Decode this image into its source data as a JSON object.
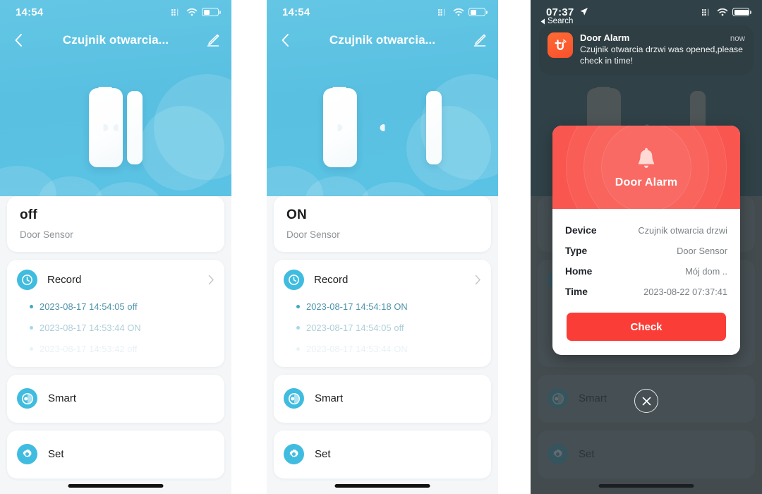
{
  "app": {
    "accent_blue": "#3fbcdf",
    "hero_blue": "#5bc3e4",
    "alarm_red": "#f9564f",
    "check_red": "#fa3e37"
  },
  "panels": [
    {
      "id": "closed-state",
      "status_bar": {
        "time": "14:54",
        "cellular_icon": "cellular-dots-icon",
        "wifi_icon": "wifi-icon",
        "battery_icon": "battery-icon",
        "battery_level": 45
      },
      "nav": {
        "back_icon": "chevron-left-icon",
        "title": "Czujnik otwarcia...",
        "edit_icon": "pencil-edit-icon"
      },
      "device": {
        "illustration": "door-sensor-closed",
        "state": "closed"
      },
      "state_card": {
        "value": "off",
        "subtitle": "Door Sensor"
      },
      "record_card": {
        "icon": "clock-icon",
        "label": "Record",
        "chevron_icon": "chevron-right-icon",
        "entries": [
          {
            "text": "2023-08-17 14:54:05 off",
            "opacity": 1.0
          },
          {
            "text": "2023-08-17 14:53:44 ON",
            "opacity": 0.45
          },
          {
            "text": "2023-08-17 14:53:42 off",
            "opacity": 0.12
          }
        ]
      },
      "rows": [
        {
          "icon": "smart-toggle-icon",
          "label": "Smart"
        },
        {
          "icon": "gear-icon",
          "label": "Set"
        }
      ]
    },
    {
      "id": "open-state",
      "status_bar": {
        "time": "14:54",
        "cellular_icon": "cellular-dots-icon",
        "wifi_icon": "wifi-icon",
        "battery_icon": "battery-icon",
        "battery_level": 45
      },
      "nav": {
        "back_icon": "chevron-left-icon",
        "title": "Czujnik otwarcia...",
        "edit_icon": "pencil-edit-icon"
      },
      "device": {
        "illustration": "door-sensor-open",
        "state": "open"
      },
      "state_card": {
        "value": "ON",
        "subtitle": "Door Sensor"
      },
      "record_card": {
        "icon": "clock-icon",
        "label": "Record",
        "chevron_icon": "chevron-right-icon",
        "entries": [
          {
            "text": "2023-08-17 14:54:18 ON",
            "opacity": 1.0
          },
          {
            "text": "2023-08-17 14:54:05 off",
            "opacity": 0.45
          },
          {
            "text": "2023-08-17 14:53:44 ON",
            "opacity": 0.12
          }
        ]
      },
      "rows": [
        {
          "icon": "smart-toggle-icon",
          "label": "Smart"
        },
        {
          "icon": "gear-icon",
          "label": "Set"
        }
      ]
    },
    {
      "id": "alarm-state",
      "status_bar": {
        "time": "07:37",
        "location_icon": "location-arrow-icon",
        "cellular_icon": "cellular-dots-icon",
        "wifi_icon": "wifi-icon",
        "battery_icon": "battery-icon",
        "battery_level": 100
      },
      "back_to_search": {
        "icon": "triangle-left-icon",
        "label": "Search"
      },
      "notification": {
        "app_icon": "tuya-app-icon",
        "title": "Door Alarm",
        "time": "now",
        "message": "Czujnik otwarcia drzwi was opened,please check in time!"
      },
      "dialog": {
        "bell_icon": "bell-icon",
        "title": "Door Alarm",
        "fields": [
          {
            "key": "Device",
            "value": "Czujnik otwarcia drzwi"
          },
          {
            "key": "Type",
            "value": "Door Sensor"
          },
          {
            "key": "Home",
            "value": "Mój dom .."
          },
          {
            "key": "Time",
            "value": "2023-08-22 07:37:41"
          }
        ],
        "button_label": "Check"
      },
      "close_icon": "close-x-icon",
      "background_rows": [
        {
          "icon": "smart-toggle-icon",
          "label": "Smart"
        },
        {
          "icon": "gear-icon",
          "label": "Set"
        }
      ]
    }
  ]
}
